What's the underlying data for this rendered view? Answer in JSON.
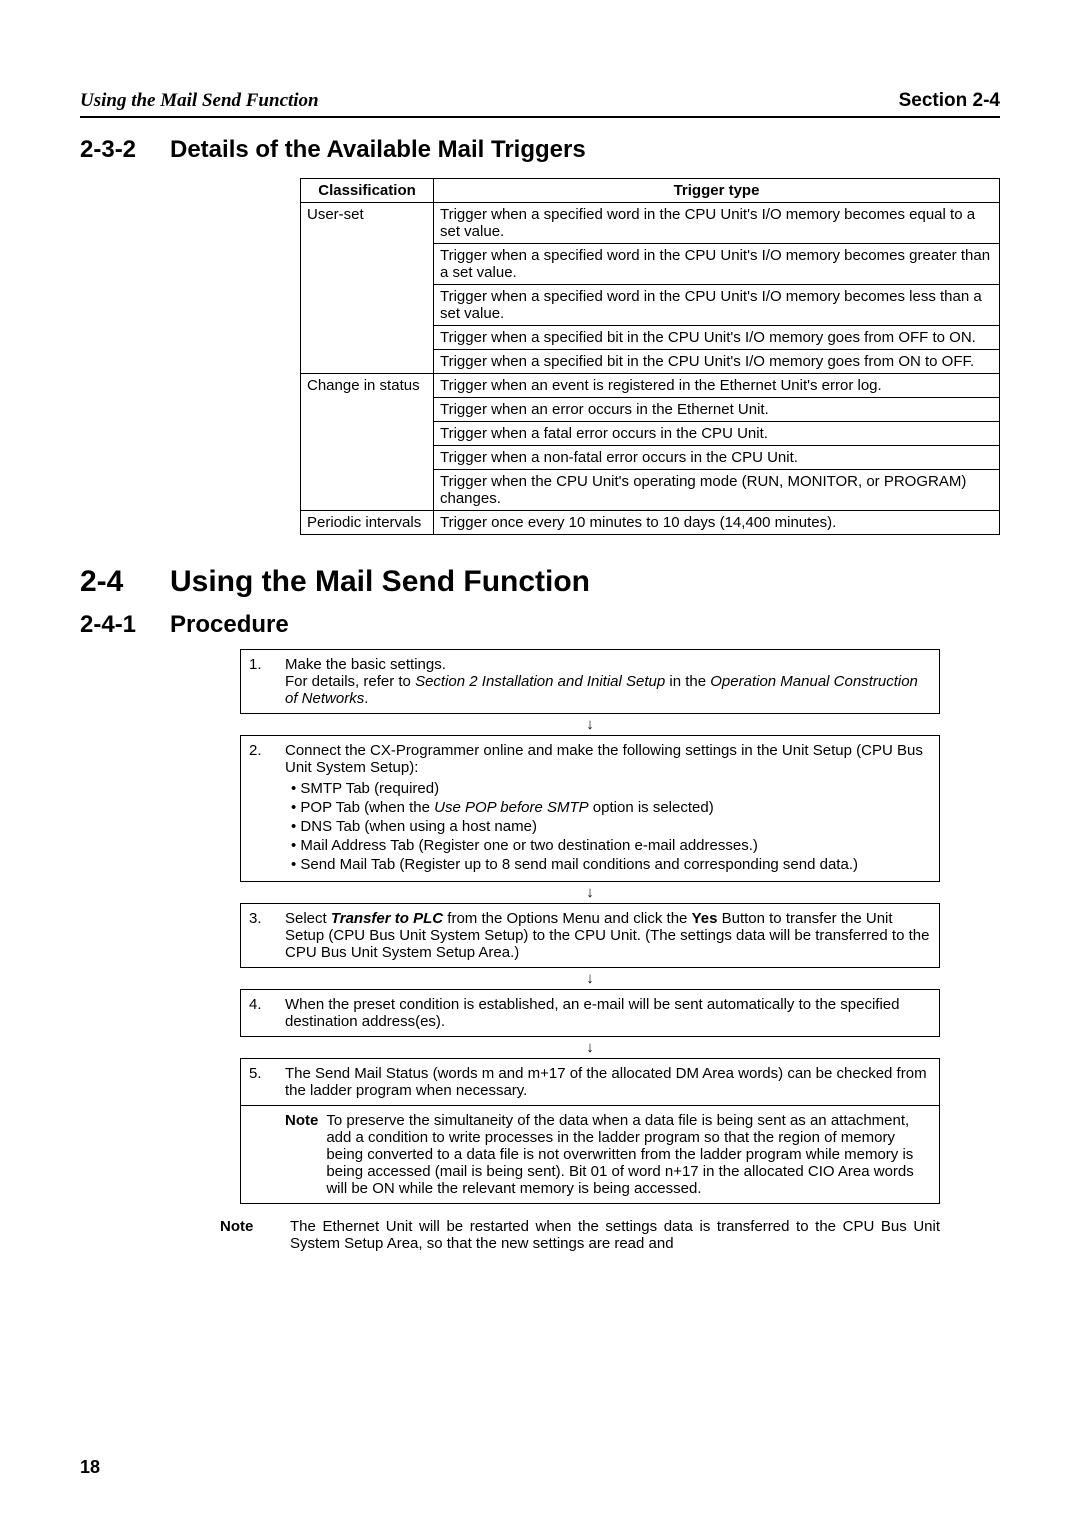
{
  "header": {
    "left": "Using the Mail Send Function",
    "right": "Section 2-4"
  },
  "section_2_3_2": {
    "num": "2-3-2",
    "title": "Details of the Available Mail Triggers",
    "table": {
      "headers": {
        "col1": "Classification",
        "col2": "Trigger type"
      },
      "groups": [
        {
          "class": "User-set",
          "rows": [
            "Trigger when a specified word in the CPU Unit's I/O memory becomes equal to a set value.",
            "Trigger when a specified word in the CPU Unit's I/O memory becomes greater than a set value.",
            "Trigger when a specified word in the CPU Unit's I/O memory becomes less than a set value.",
            "Trigger when a specified bit in the CPU Unit's I/O memory goes from OFF to ON.",
            "Trigger when a specified bit in the CPU Unit's I/O memory goes from ON to OFF."
          ]
        },
        {
          "class": "Change in status",
          "rows": [
            "Trigger when an event is registered in the Ethernet Unit's error log.",
            "Trigger when an error occurs in the Ethernet Unit.",
            "Trigger when a fatal error occurs in the CPU Unit.",
            "Trigger when a non-fatal error occurs in the CPU Unit.",
            "Trigger when the CPU Unit's operating mode (RUN, MONITOR, or PROGRAM) changes."
          ]
        },
        {
          "class": "Periodic intervals",
          "rows": [
            "Trigger once every 10 minutes to 10 days (14,400 minutes)."
          ]
        }
      ]
    }
  },
  "section_2_4": {
    "num": "2-4",
    "title": "Using the Mail Send Function"
  },
  "section_2_4_1": {
    "num": "2-4-1",
    "title": "Procedure",
    "arrow": "↓",
    "steps": {
      "s1": {
        "num": "1.",
        "line1": "Make the basic settings.",
        "line2a": "For details, refer to ",
        "line2b": "Section 2 Installation and Initial Setup",
        "line2c": " in the ",
        "line2d": "Operation Manual Construction of Networks",
        "line2e": "."
      },
      "s2": {
        "num": "2.",
        "intro": "Connect the CX-Programmer online and make the following settings in the Unit Setup (CPU Bus Unit System Setup):",
        "b1": "SMTP Tab (required)",
        "b2a": "POP Tab (when the ",
        "b2b": "Use POP before SMTP",
        "b2c": " option is selected)",
        "b3": "DNS Tab (when using a host name)",
        "b4": "Mail Address Tab (Register one or two destination e-mail addresses.)",
        "b5": "Send Mail Tab (Register up to 8 send mail conditions and corresponding send data.)"
      },
      "s3": {
        "num": "3.",
        "a": "Select ",
        "b": "Transfer to PLC",
        "c": " from the Options Menu and click the ",
        "d": "Yes",
        "e": " Button to transfer the Unit Setup (CPU Bus Unit System Setup) to the CPU Unit. (The settings data will be transferred to the CPU Bus Unit System Setup Area.)"
      },
      "s4": {
        "num": "4.",
        "text": "When the preset condition is established, an e-mail will be sent automatically to the specified destination address(es)."
      },
      "s5": {
        "num": "5.",
        "text": "The Send Mail Status (words m and m+17 of the allocated DM Area words) can be checked from the ladder program when necessary.",
        "note_label": "Note",
        "note_text": "To preserve the simultaneity of the data when a data file is being sent as an attachment, add a condition to write processes in the ladder program so that the region of memory being converted to a data file is not overwritten from the ladder program while memory is being accessed (mail is being sent). Bit 01 of word n+17 in the allocated CIO Area words will be ON while the relevant memory is being accessed."
      }
    },
    "footer_note": {
      "label": "Note",
      "text": "The Ethernet Unit will be restarted when the settings data is transferred to the CPU Bus Unit System Setup Area, so that the new settings are read and"
    }
  },
  "page_number": "18"
}
